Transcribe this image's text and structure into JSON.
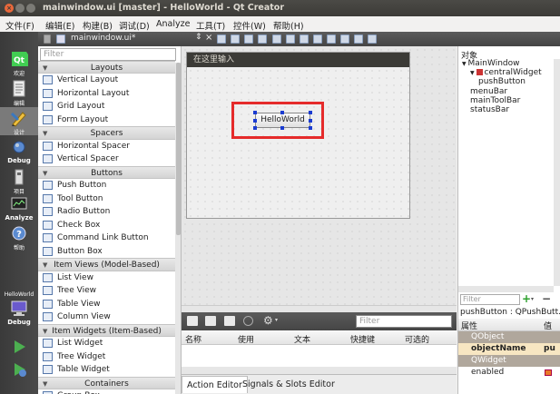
{
  "window": {
    "title": "mainwindow.ui [master] - HelloWorld - Qt Creator"
  },
  "menu": [
    "文件(F)",
    "编辑(E)",
    "构建(B)",
    "调试(D)",
    "Analyze",
    "工具(T)",
    "控件(W)",
    "帮助(H)"
  ],
  "modes": [
    {
      "label": "欢迎",
      "icon": "qt-logo-icon"
    },
    {
      "label": "编辑",
      "icon": "edit-document-icon"
    },
    {
      "label": "设计",
      "icon": "design-pencil-icon"
    },
    {
      "label": "Debug",
      "icon": "debug-bug-icon"
    },
    {
      "label": "项目",
      "icon": "projects-wrench-icon"
    },
    {
      "label": "Analyze",
      "icon": "analyze-monitor-icon"
    },
    {
      "label": "帮助",
      "icon": "help-icon"
    }
  ],
  "build_target": {
    "project": "HelloWorld",
    "mode": "Debug"
  },
  "editor": {
    "file": "mainwindow.ui*"
  },
  "widgetbox": {
    "filter_placeholder": "Filter",
    "rows": [
      {
        "type": "cat",
        "label": "Layouts"
      },
      {
        "type": "item",
        "label": "Vertical Layout"
      },
      {
        "type": "item",
        "label": "Horizontal Layout"
      },
      {
        "type": "item",
        "label": "Grid Layout"
      },
      {
        "type": "item",
        "label": "Form Layout"
      },
      {
        "type": "cat",
        "label": "Spacers"
      },
      {
        "type": "item",
        "label": "Horizontal Spacer"
      },
      {
        "type": "item",
        "label": "Vertical Spacer"
      },
      {
        "type": "cat",
        "label": "Buttons"
      },
      {
        "type": "item",
        "label": "Push Button"
      },
      {
        "type": "item",
        "label": "Tool Button"
      },
      {
        "type": "item",
        "label": "Radio Button"
      },
      {
        "type": "item",
        "label": "Check Box"
      },
      {
        "type": "item",
        "label": "Command Link Button"
      },
      {
        "type": "item",
        "label": "Button Box"
      },
      {
        "type": "cat",
        "label": "Item Views (Model-Based)"
      },
      {
        "type": "item",
        "label": "List View"
      },
      {
        "type": "item",
        "label": "Tree View"
      },
      {
        "type": "item",
        "label": "Table View"
      },
      {
        "type": "item",
        "label": "Column View"
      },
      {
        "type": "cat",
        "label": "Item Widgets (Item-Based)"
      },
      {
        "type": "item",
        "label": "List Widget"
      },
      {
        "type": "item",
        "label": "Tree Widget"
      },
      {
        "type": "item",
        "label": "Table Widget"
      },
      {
        "type": "cat",
        "label": "Containers"
      },
      {
        "type": "item",
        "label": "Group Box"
      }
    ]
  },
  "form": {
    "menu_placeholder": "在这里输入",
    "button_text": "HelloWorld"
  },
  "action_editor": {
    "filter_placeholder": "Filter",
    "columns": [
      "名称",
      "使用",
      "文本",
      "快捷键",
      "可选的"
    ],
    "tabs": [
      "Action Editor",
      "Signals & Slots Editor"
    ]
  },
  "object_inspector": {
    "header": "对象",
    "tree": [
      {
        "label": "MainWindow",
        "depth": 0,
        "arrow": "▼"
      },
      {
        "label": "centralWidget",
        "depth": 1,
        "arrow": "▼"
      },
      {
        "label": "pushButton",
        "depth": 2,
        "arrow": ""
      },
      {
        "label": "menuBar",
        "depth": 1,
        "arrow": ""
      },
      {
        "label": "mainToolBar",
        "depth": 1,
        "arrow": ""
      },
      {
        "label": "statusBar",
        "depth": 1,
        "arrow": ""
      }
    ]
  },
  "property_editor": {
    "filter_placeholder": "Filter",
    "title": "pushButton : QPushButt...",
    "header_prop": "属性",
    "header_value": "值",
    "rows": [
      {
        "type": "group",
        "label": "QObject"
      },
      {
        "type": "prop",
        "label": "objectName",
        "value": "pu",
        "highlight": true
      },
      {
        "type": "group",
        "label": "QWidget"
      },
      {
        "type": "prop",
        "label": "enabled",
        "value": "",
        "highlight": false
      }
    ]
  },
  "colors": {
    "highlight_box": "#e52b2b",
    "selection_handle": "#1a3bd1",
    "mode_bar": "#3f3f3f"
  }
}
